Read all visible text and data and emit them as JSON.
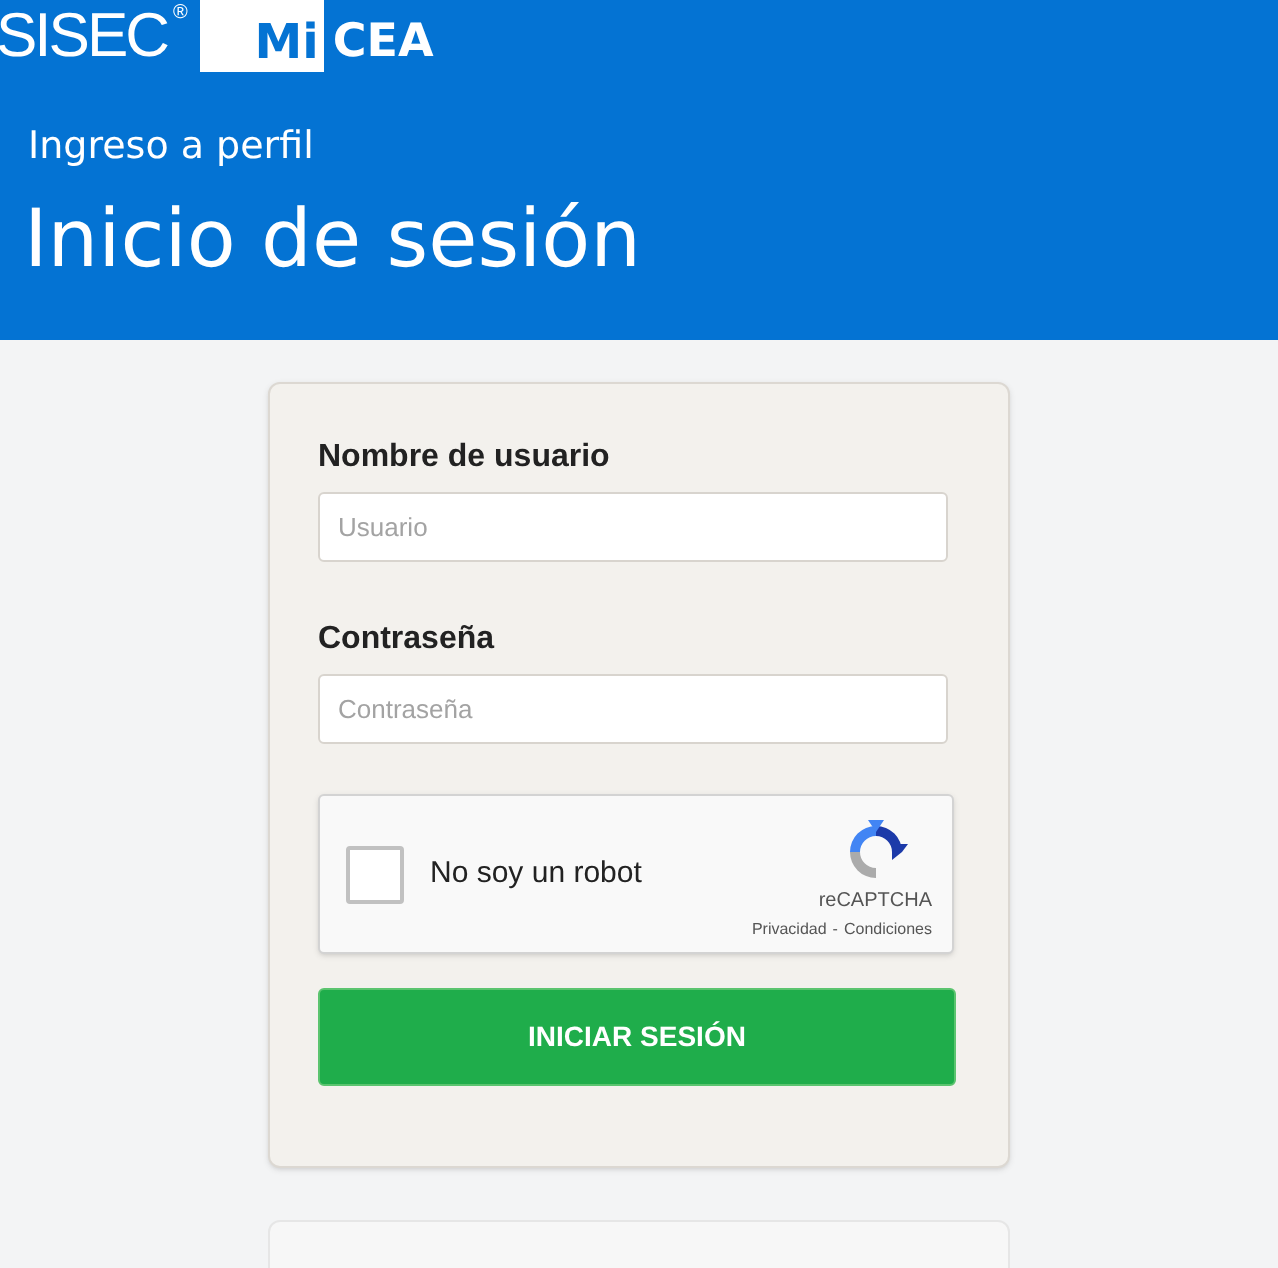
{
  "header": {
    "logo": {
      "sisec": "SISEC$^{®}$",
      "mi": "Mi",
      "cea": "CEA"
    },
    "subtitle": "Ingreso a perfil",
    "title": "Inicio de sesión"
  },
  "form": {
    "fields": [
      {
        "label": "Nombre de usuario",
        "placeholder": "Usuario"
      },
      {
        "label": "Contraseña",
        "placeholder": "Contraseña"
      }
    ],
    "captcha": {
      "checked": false,
      "label": "No soy un robot",
      "brand": "reCAPTCHA",
      "privacy_link": "Privacidad",
      "separator": "-",
      "terms_link": "Condiciones"
    },
    "submit": "INICIAR SESIÓN"
  }
}
